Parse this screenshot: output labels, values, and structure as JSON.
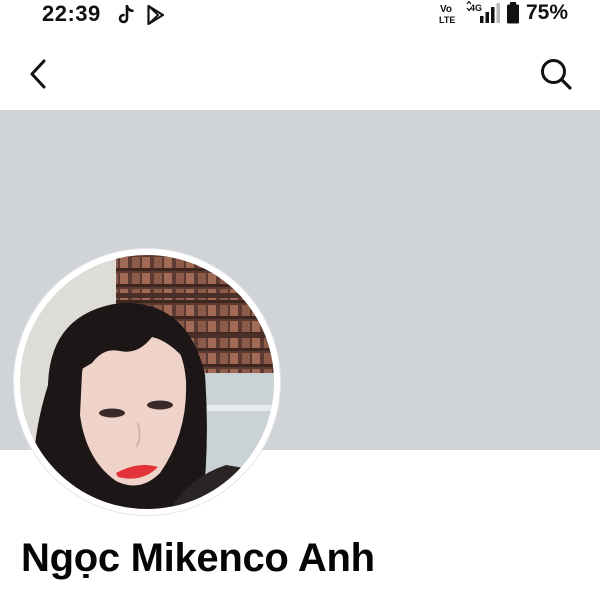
{
  "status_bar": {
    "time": "22:39",
    "battery_percent": "75%",
    "network_label_top": "Vo",
    "network_label_bottom": "LTE",
    "data_type": "4G",
    "icons": [
      "tiktok-icon",
      "play-store-icon",
      "volte-icon",
      "signal-icon",
      "battery-icon"
    ]
  },
  "app_bar": {
    "back_icon": "chevron-left-icon",
    "search_icon": "search-icon"
  },
  "profile": {
    "name": "Ngọc Mikenco Anh"
  },
  "colors": {
    "cover": "#d0d3d8",
    "text": "#050505",
    "background": "#ffffff"
  }
}
